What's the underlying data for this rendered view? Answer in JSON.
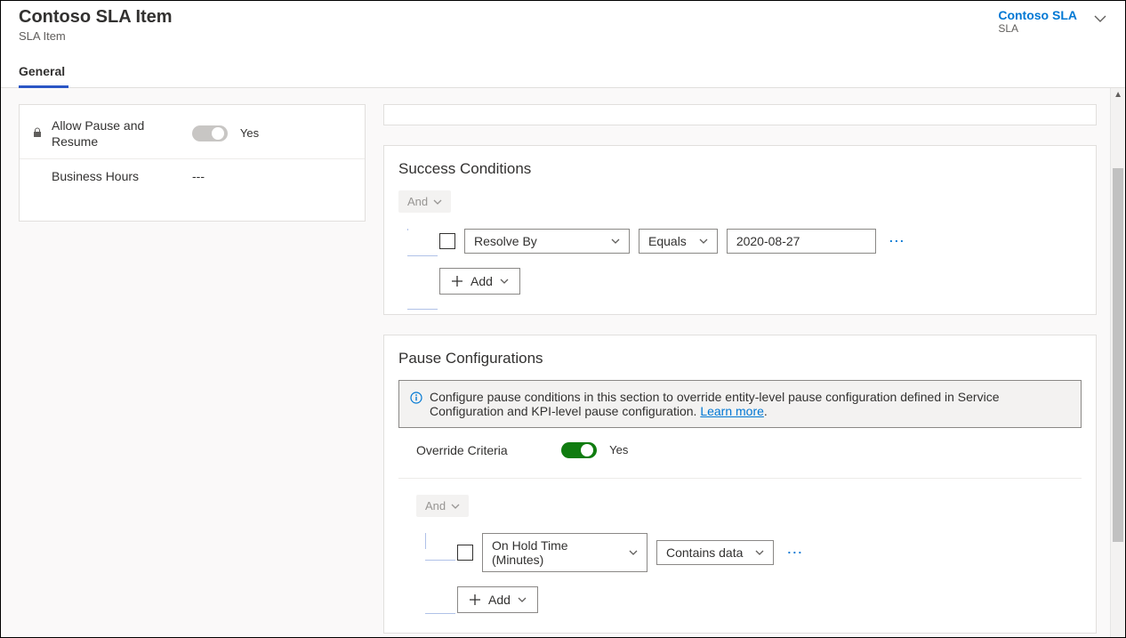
{
  "header": {
    "title": "Contoso SLA Item",
    "subtitle": "SLA Item",
    "related_link": "Contoso SLA",
    "related_sub": "SLA"
  },
  "tabs": {
    "active": "General"
  },
  "sidebar": {
    "allow_pause_label": "Allow Pause and Resume",
    "allow_pause_value": "Yes",
    "business_hours_label": "Business Hours",
    "business_hours_value": "---"
  },
  "success": {
    "title": "Success Conditions",
    "group_op": "And",
    "row": {
      "field": "Resolve By",
      "operator": "Equals",
      "value": "2020-08-27"
    },
    "add_label": "Add"
  },
  "pause": {
    "title": "Pause Configurations",
    "info_text": "Configure pause conditions in this section to override entity-level pause configuration defined in Service Configuration and KPI-level pause configuration. ",
    "info_link": "Learn more",
    "override_label": "Override Criteria",
    "override_value": "Yes",
    "group_op": "And",
    "row": {
      "field": "On Hold Time (Minutes)",
      "operator": "Contains data"
    },
    "add_label": "Add"
  }
}
